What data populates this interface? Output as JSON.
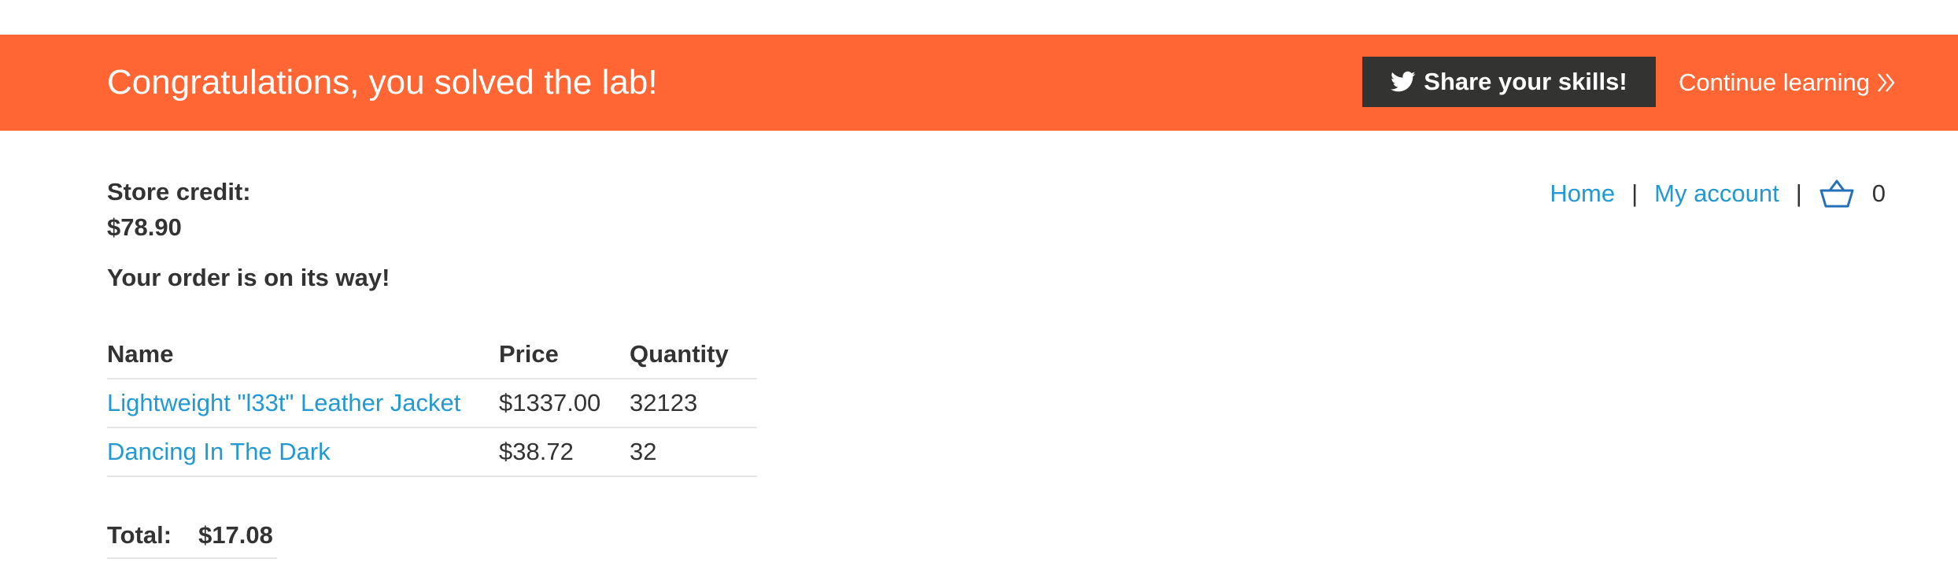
{
  "banner": {
    "title": "Congratulations, you solved the lab!",
    "share_label": "Share your skills!",
    "continue_label": "Continue learning",
    "background_color": "#ff6633",
    "share_icon": "twitter-icon",
    "continue_icon": "double-chevron-right-icon"
  },
  "account": {
    "store_credit_label": "Store credit:",
    "store_credit_value": "$78.90"
  },
  "nav": {
    "home": "Home",
    "separator": "|",
    "my_account": "My account",
    "cart_icon": "basket-icon",
    "cart_count": "0",
    "link_color": "#2199d3"
  },
  "order": {
    "message": "Your order is on its way!",
    "columns": [
      "Name",
      "Price",
      "Quantity"
    ],
    "items": [
      {
        "name": "Lightweight \"l33t\" Leather Jacket",
        "price": "$1337.00",
        "quantity": "32123"
      },
      {
        "name": "Dancing In The Dark",
        "price": "$38.72",
        "quantity": "32"
      }
    ],
    "total_label": "Total:",
    "total_value": "$17.08"
  }
}
